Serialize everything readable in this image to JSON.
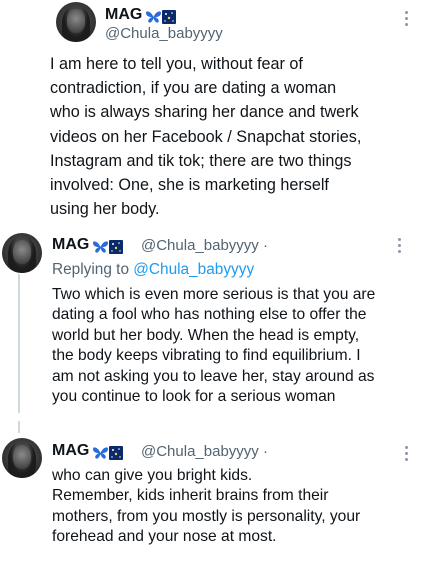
{
  "tweets": [
    {
      "name": "MAG",
      "handle": "@Chula_babyyyy",
      "text": "I am here to tell you, without fear of\ncontradiction, if you are dating a woman\nwho is always sharing her dance and twerk\nvideos on her Facebook / Snapchat stories,\nInstagram and tik tok; there are two things\ninvolved: One, she is marketing herself\nusing her body."
    },
    {
      "name": "MAG",
      "handle": "@Chula_babyyyy",
      "separator": "·",
      "replying_prefix": "Replying to",
      "replying_mention": "@Chula_babyyyy",
      "text": "Two which is even more serious is that you are\ndating a fool who has nothing else to offer the\nworld but her body. When the head is empty,\nthe body keeps vibrating to find equilibrium. I\nam not asking you to leave her, stay around as\nyou continue to look for a serious woman"
    },
    {
      "name": "MAG",
      "handle": "@Chula_babyyyy",
      "separator": "·",
      "text": "who can give you bright kids.\nRemember, kids inherit brains from their\nmothers, from you mostly is personality, your\nforehead and your nose at most."
    }
  ],
  "icons": {
    "name_emoji_1": "blue-butterfly-icon",
    "name_emoji_2": "night-sky-icon",
    "more": "more-options-icon",
    "avatar": "profile-photo"
  },
  "colors": {
    "text": "#0f1419",
    "secondary": "#536471",
    "mention": "#1d9bf0",
    "thread_line": "#cfd9de"
  }
}
